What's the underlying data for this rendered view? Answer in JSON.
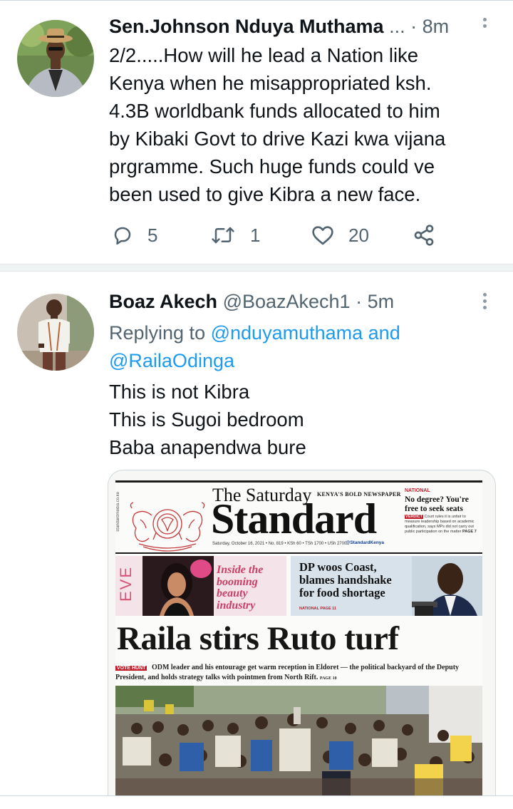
{
  "tweets": [
    {
      "author_name": "Sen.Johnson Nduya Muthama",
      "handle_truncated": "...",
      "separator": "·",
      "time": "8m",
      "text_lines": [
        "2/2.....How will he lead a Nation like",
        "Kenya when he misappropriated ksh.",
        "4.3B worldbank funds allocated to him",
        "by Kibaki Govt to drive Kazi kwa vijana",
        "prgramme. Such huge funds could ve",
        "been used to give Kibra a new face."
      ],
      "actions": {
        "replies": "5",
        "retweets": "1",
        "likes": "20"
      }
    },
    {
      "author_name": "Boaz Akech",
      "handle": "@BoazAkech1",
      "separator": "·",
      "time": "5m",
      "replying_prefix": "Replying to",
      "replying_to_1": "@nduyamuthama",
      "replying_and": "and",
      "replying_to_2": "@RailaOdinga",
      "text_lines": [
        "This is not Kibra",
        "This is Sugoi bedroom",
        "Baba anapendwa bure"
      ]
    }
  ],
  "newspaper": {
    "title_small": "The Saturday",
    "title_large": "Standard",
    "tagline": "KENYA'S BOLD NEWSPAPER",
    "side_text": "standardmedia.co.ke",
    "dateline": "Saturday, October 16, 2021 • No. 819 • KSh 60 • TSh 1700 • USh 2700",
    "social": "@StandardKenya",
    "national_tag": "NATIONAL",
    "national_headline_1": "No degree? You're",
    "national_headline_2": "free to seek seats",
    "national_verdict": "VERDICT",
    "national_text": "Court rules it is unfair to measure leadership based on academic qualification, says MPs did not carry out public participation on the matter",
    "national_page": "PAGE 7",
    "eve_label": "EVE",
    "eve_teaser_1": "Inside the",
    "eve_teaser_2": "booming",
    "eve_teaser_3": "beauty",
    "eve_teaser_4": "industry",
    "dp_line_1": "DP woos Coast,",
    "dp_line_2": "blames handshake",
    "dp_line_3": "for food shortage",
    "dp_tag": "NATIONAL PAGE 11",
    "main_headline": "Raila stirs Ruto turf",
    "vote_hunt_tag": "VOTE HUNT",
    "deck_text": "ODM leader and his entourage get warm reception in Eldoret — the political backyard of the Deputy President, and holds strategy talks with pointmen from North Rift.",
    "deck_page": "PAGE 10"
  },
  "colors": {
    "link": "#1d9bf0",
    "secondary_text": "#536471",
    "primary_text": "#0f1419",
    "border": "#cfd9de"
  },
  "icons": [
    "reply-icon",
    "retweet-icon",
    "like-icon",
    "share-icon",
    "more-menu-icon"
  ]
}
